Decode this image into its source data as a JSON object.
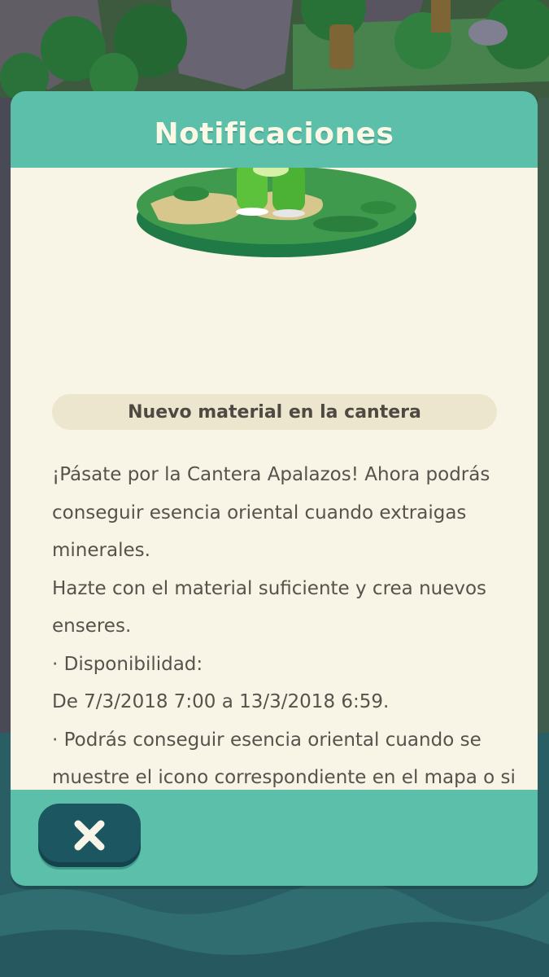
{
  "dialog": {
    "title": "Notificaciones",
    "subtitle": "Nuevo material en la cantera",
    "message_lines": [
      "¡Pásate por la Cantera Apalazos! Ahora podrás conseguir esencia oriental cuando extraigas minerales.",
      "Hazte con el material suficiente y crea nuevos enseres.",
      "· Disponibilidad:",
      "De 7/3/2018 7:00 a 13/3/2018 6:59.",
      "· Podrás conseguir esencia oriental cuando se muestre el icono correspondiente en el mapa o si llevas a cabo recados para los campistas."
    ]
  },
  "footer": {
    "close_icon": "close-x-icon"
  },
  "colors": {
    "header": "#5bbfa9",
    "body_bg": "#f8f5e6",
    "pill_bg": "#ede6cf",
    "text": "#57524b",
    "button": "#1c5660"
  }
}
